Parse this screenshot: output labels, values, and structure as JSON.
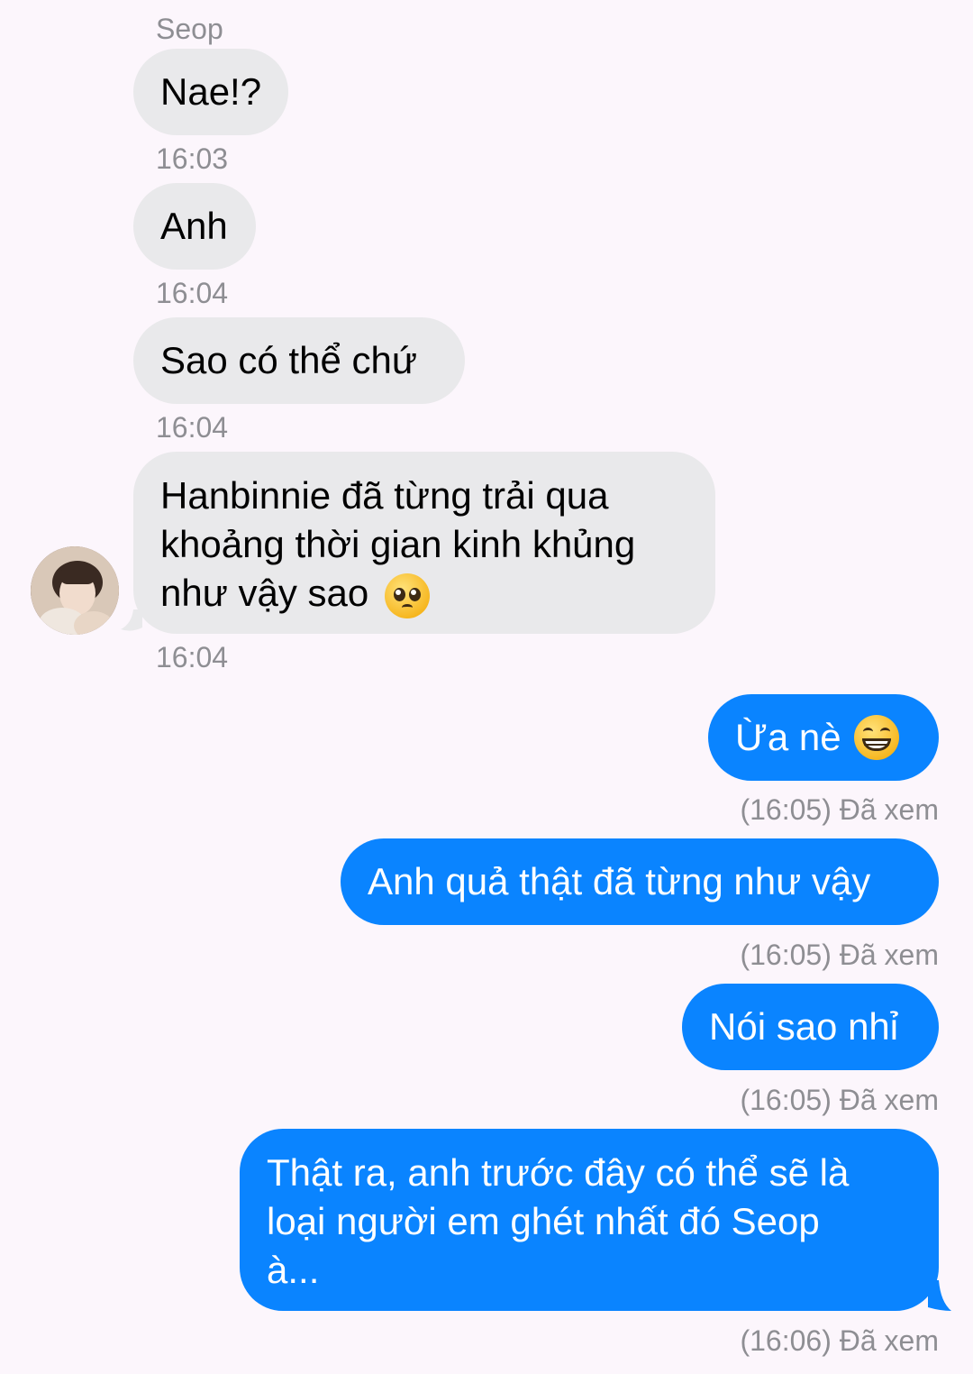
{
  "chat": {
    "sender_name": "Seop",
    "incoming": [
      {
        "text": "Nae!?",
        "time": "16:03"
      },
      {
        "text": "Anh",
        "time": "16:04"
      },
      {
        "text": "Sao có thể chứ",
        "time": "16:04"
      },
      {
        "lines": [
          "Hanbinnie đã từng trải qua",
          "khoảng thời gian kinh khủng",
          "như vậy sao"
        ],
        "time": "16:04",
        "emoji": "pleading-face-icon"
      }
    ],
    "outgoing": [
      {
        "text": "Ừa nè",
        "status": "(16:05) Đã xem",
        "emoji": "grinning-face-icon"
      },
      {
        "text": "Anh quả thật đã từng như vậy",
        "status": "(16:05) Đã xem"
      },
      {
        "text": "Nói sao nhỉ",
        "status": "(16:05) Đã xem"
      },
      {
        "lines": [
          "Thật ra, anh trước đây có thể sẽ là",
          "loại người em ghét nhất đó Seop",
          "à..."
        ],
        "status": "(16:06) Đã xem"
      }
    ]
  },
  "colors": {
    "background": "#fcf6fc",
    "incoming_bubble": "#e9e9eb",
    "outgoing_bubble": "#0a84ff",
    "meta_text": "#8e8e93"
  }
}
